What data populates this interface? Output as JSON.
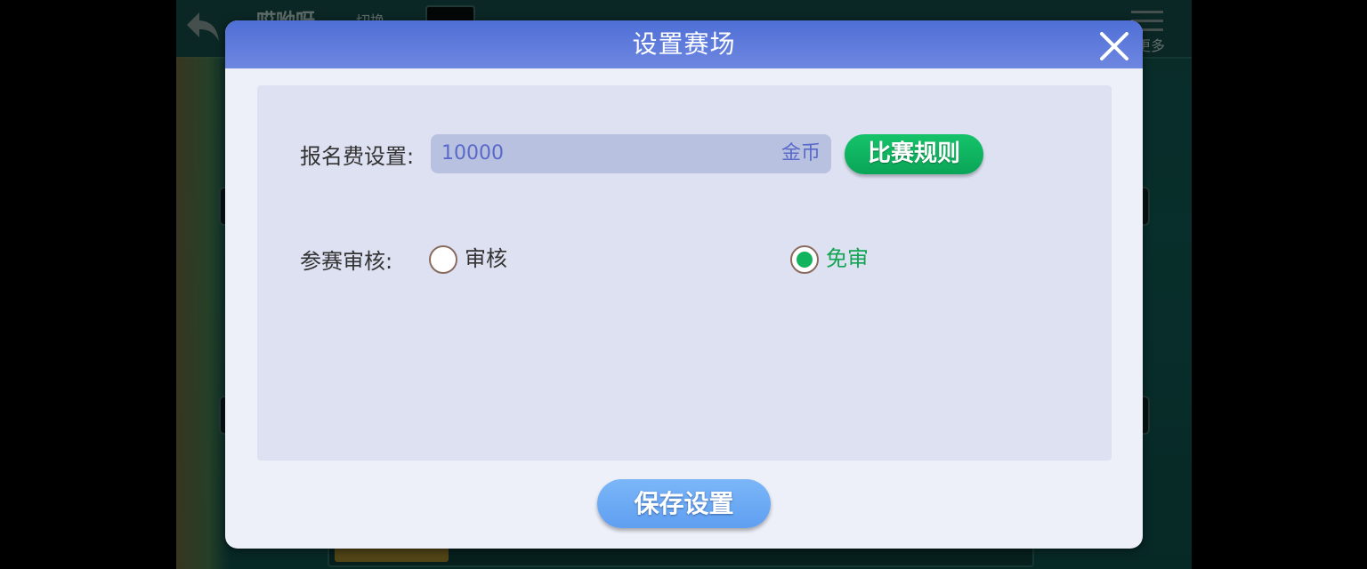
{
  "background": {
    "title": "哎呦呀",
    "switch_label": "切换",
    "more_label": "更多"
  },
  "dialog": {
    "title": "设置赛场",
    "close_icon": "close-icon",
    "fee": {
      "label": "报名费设置:",
      "value": "10000",
      "unit": "金币"
    },
    "rules_button": "比赛规则",
    "review": {
      "label": "参赛审核:",
      "options": [
        {
          "label": "审核",
          "selected": false
        },
        {
          "label": "免审",
          "selected": true
        }
      ]
    },
    "save_button": "保存设置"
  },
  "colors": {
    "header": "#5b79da",
    "panel": "#dde1f1",
    "accent_green": "#12b35d",
    "save_blue": "#6aa8f4",
    "input_text": "#5a6ac9"
  }
}
